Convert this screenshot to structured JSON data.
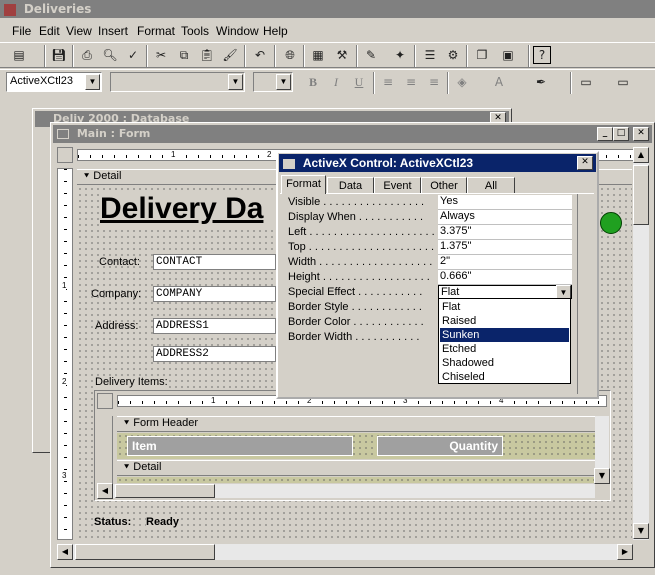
{
  "app": {
    "title": "Deliveries"
  },
  "menu": [
    "File",
    "Edit",
    "View",
    "Insert",
    "Format",
    "Tools",
    "Window",
    "Help"
  ],
  "formatting_bar": {
    "object_combo": "ActiveXCtl23",
    "bold": "B",
    "italic": "I",
    "underline": "U"
  },
  "back_window": {
    "title": "Deliv 2000 : Database"
  },
  "form_window": {
    "title": "Main : Form"
  },
  "ruler": {
    "marks": [
      "1",
      "2"
    ]
  },
  "form": {
    "detail_label": "Detail",
    "title": "Delivery Da",
    "contact_label": "Contact:",
    "contact_value": "CONTACT",
    "company_label": "Company:",
    "company_value": "COMPANY",
    "address_label": "Address:",
    "address1_value": "ADDRESS1",
    "address2_value": "ADDRESS2",
    "delivery_items_label": "Delivery Items:",
    "status_label": "Status:",
    "status_value": "Ready",
    "vertical_marks": [
      "1",
      "2",
      "3"
    ]
  },
  "subform": {
    "form_header_label": "Form Header",
    "item_header": "Item",
    "quantity_header": "Quantity",
    "detail_label": "Detail",
    "ruler_marks": [
      "1",
      "2",
      "3",
      "4"
    ]
  },
  "properties": {
    "title": "ActiveX Control: ActiveXCtl23",
    "tabs": [
      "Format",
      "Data",
      "Event",
      "Other",
      "All"
    ],
    "active_tab": "Format",
    "rows": [
      {
        "name": "Visible . . . . . . . . . . . . . . . . .",
        "value": "Yes"
      },
      {
        "name": "Display When . . . . . . . . . . .",
        "value": "Always"
      },
      {
        "name": "Left . . . . . . . . . . . . . . . . . . . . .",
        "value": "3.375\""
      },
      {
        "name": "Top . . . . . . . . . . . . . . . . . . . . .",
        "value": "1.375\""
      },
      {
        "name": "Width . . . . . . . . . . . . . . . . . . .",
        "value": "2\""
      },
      {
        "name": "Height . . . . . . . . . . . . . . . . . .",
        "value": "0.666\""
      },
      {
        "name": "Special Effect . . . . . . . . . . .",
        "value": "Flat"
      },
      {
        "name": "Border Style . . . . . . . . . . . .",
        "value": ""
      },
      {
        "name": "Border Color . . . . . . . . . . . .",
        "value": ""
      },
      {
        "name": "Border Width . . . . . . . . . . .",
        "value": ""
      }
    ],
    "dropdown_options": [
      "Flat",
      "Raised",
      "Sunken",
      "Etched",
      "Shadowed",
      "Chiseled"
    ],
    "selected_option": "Sunken"
  },
  "colors": {
    "active_title": "#0a246a",
    "inactive_title": "#808080",
    "selection": "#0a246a",
    "face": "#d4d0c8"
  }
}
